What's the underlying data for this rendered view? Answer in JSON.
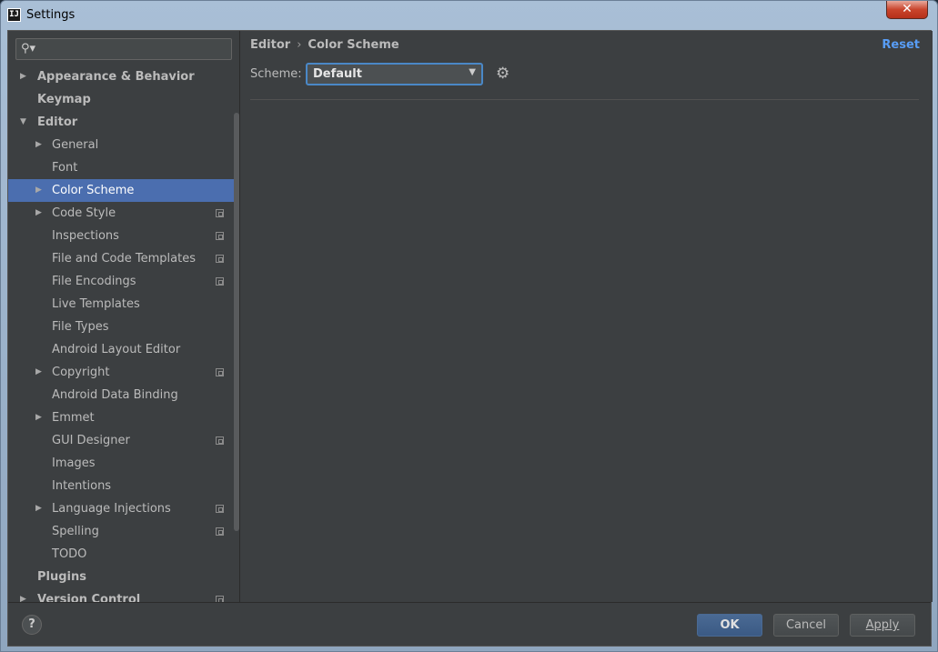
{
  "window": {
    "title": "Settings",
    "app_icon": "IJ",
    "close_glyph": "✕"
  },
  "sidebar": {
    "search_placeholder": "",
    "search_icon": "magnifier-with-dropdown",
    "items": [
      {
        "label": "Appearance & Behavior",
        "level": 0,
        "arrow": "▶",
        "project": false
      },
      {
        "label": "Keymap",
        "level": 0,
        "arrow": "",
        "project": false
      },
      {
        "label": "Editor",
        "level": 0,
        "arrow": "▼",
        "project": false
      },
      {
        "label": "General",
        "level": 1,
        "arrow": "▶",
        "project": false
      },
      {
        "label": "Font",
        "level": 1,
        "arrow": "",
        "project": false
      },
      {
        "label": "Color Scheme",
        "level": 1,
        "arrow": "▶",
        "project": false,
        "selected": true
      },
      {
        "label": "Code Style",
        "level": 1,
        "arrow": "▶",
        "project": true
      },
      {
        "label": "Inspections",
        "level": 1,
        "arrow": "",
        "project": true
      },
      {
        "label": "File and Code Templates",
        "level": 1,
        "arrow": "",
        "project": true
      },
      {
        "label": "File Encodings",
        "level": 1,
        "arrow": "",
        "project": true
      },
      {
        "label": "Live Templates",
        "level": 1,
        "arrow": "",
        "project": false
      },
      {
        "label": "File Types",
        "level": 1,
        "arrow": "",
        "project": false
      },
      {
        "label": "Android Layout Editor",
        "level": 1,
        "arrow": "",
        "project": false
      },
      {
        "label": "Copyright",
        "level": 1,
        "arrow": "▶",
        "project": true
      },
      {
        "label": "Android Data Binding",
        "level": 1,
        "arrow": "",
        "project": false
      },
      {
        "label": "Emmet",
        "level": 1,
        "arrow": "▶",
        "project": false
      },
      {
        "label": "GUI Designer",
        "level": 1,
        "arrow": "",
        "project": true
      },
      {
        "label": "Images",
        "level": 1,
        "arrow": "",
        "project": false
      },
      {
        "label": "Intentions",
        "level": 1,
        "arrow": "",
        "project": false
      },
      {
        "label": "Language Injections",
        "level": 1,
        "arrow": "▶",
        "project": true
      },
      {
        "label": "Spelling",
        "level": 1,
        "arrow": "",
        "project": true
      },
      {
        "label": "TODO",
        "level": 1,
        "arrow": "",
        "project": false
      },
      {
        "label": "Plugins",
        "level": 0,
        "arrow": "",
        "project": false
      },
      {
        "label": "Version Control",
        "level": 0,
        "arrow": "▶",
        "project": true
      }
    ]
  },
  "content": {
    "breadcrumb": [
      "Editor",
      "Color Scheme"
    ],
    "breadcrumb_sep": "›",
    "reset_label": "Reset",
    "scheme_label": "Scheme:",
    "scheme_value": "Default",
    "scheme_caret": "▼",
    "gear_glyph": "⚙"
  },
  "footer": {
    "help_label": "?",
    "ok_label": "OK",
    "cancel_label": "Cancel",
    "apply_label": "Apply"
  },
  "colors": {
    "selection": "#4b6eaf",
    "link": "#589df6",
    "background": "#3c3f41"
  }
}
